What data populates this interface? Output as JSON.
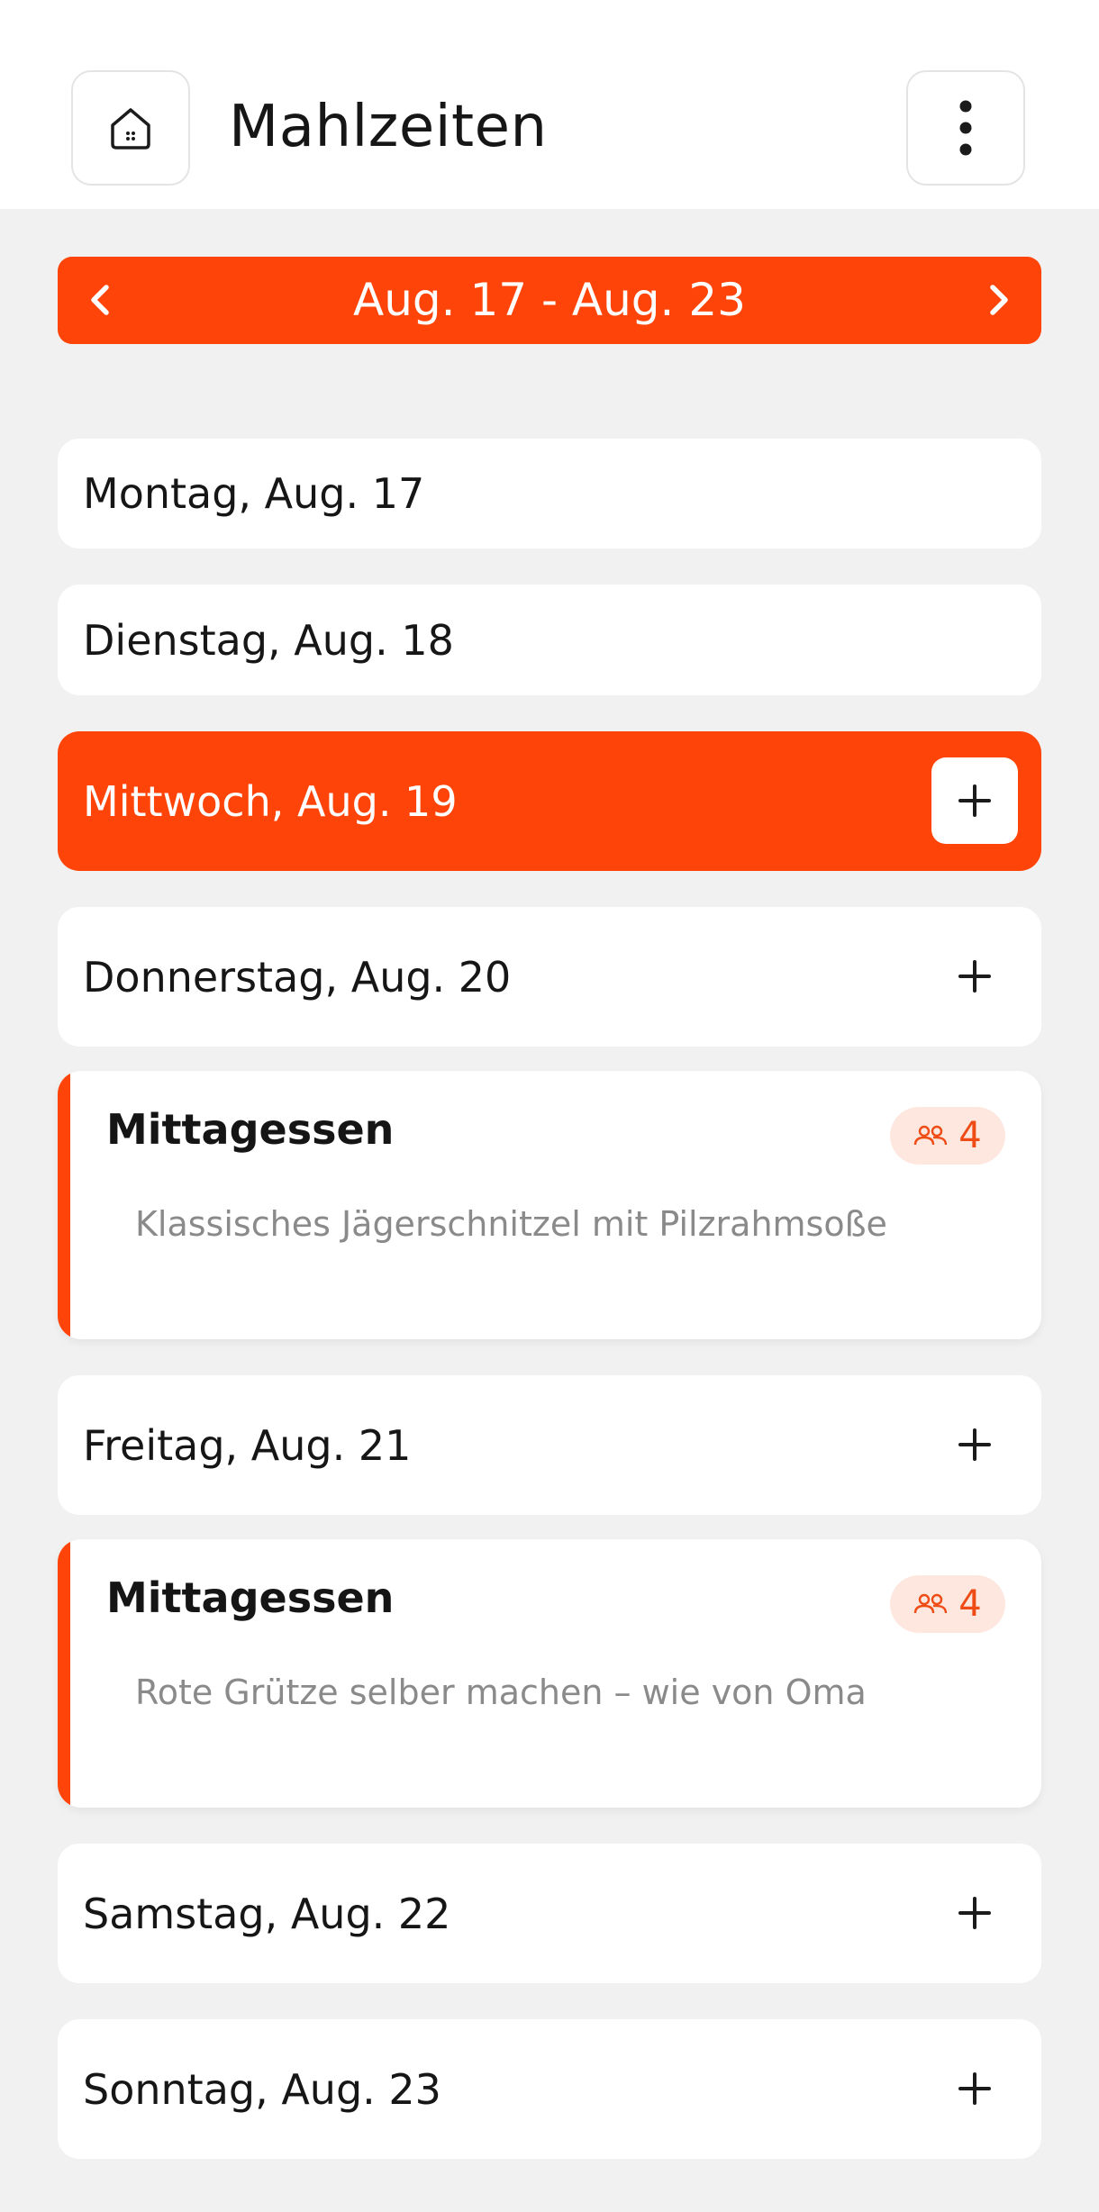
{
  "header": {
    "title": "Mahlzeiten",
    "home_icon": "home-icon",
    "menu_icon": "more-vertical-icon"
  },
  "week": {
    "range": "Aug. 17 - Aug. 23",
    "prev_icon": "chevron-left-icon",
    "next_icon": "chevron-right-icon"
  },
  "days": [
    {
      "label": "Montag, Aug. 17"
    },
    {
      "label": "Dienstag, Aug. 18"
    },
    {
      "label": "Mittwoch, Aug. 19"
    },
    {
      "label": "Donnerstag, Aug. 20"
    },
    {
      "label": "Freitag, Aug. 21"
    },
    {
      "label": "Samstag, Aug. 22"
    },
    {
      "label": "Sonntag, Aug. 23"
    }
  ],
  "meals": [
    {
      "type": "Mittagessen",
      "people": "4",
      "title": "Klassisches Jägerschnitzel mit Pilzrahmsoße"
    },
    {
      "type": "Mittagessen",
      "people": "4",
      "title": "Rote Grütze selber machen – wie von Oma"
    }
  ],
  "colors": {
    "accent": "#fe4408",
    "background": "#f2f1f1",
    "card": "#ffffff",
    "badge_bg": "#fde7df",
    "muted_text": "#8a8a8a"
  }
}
